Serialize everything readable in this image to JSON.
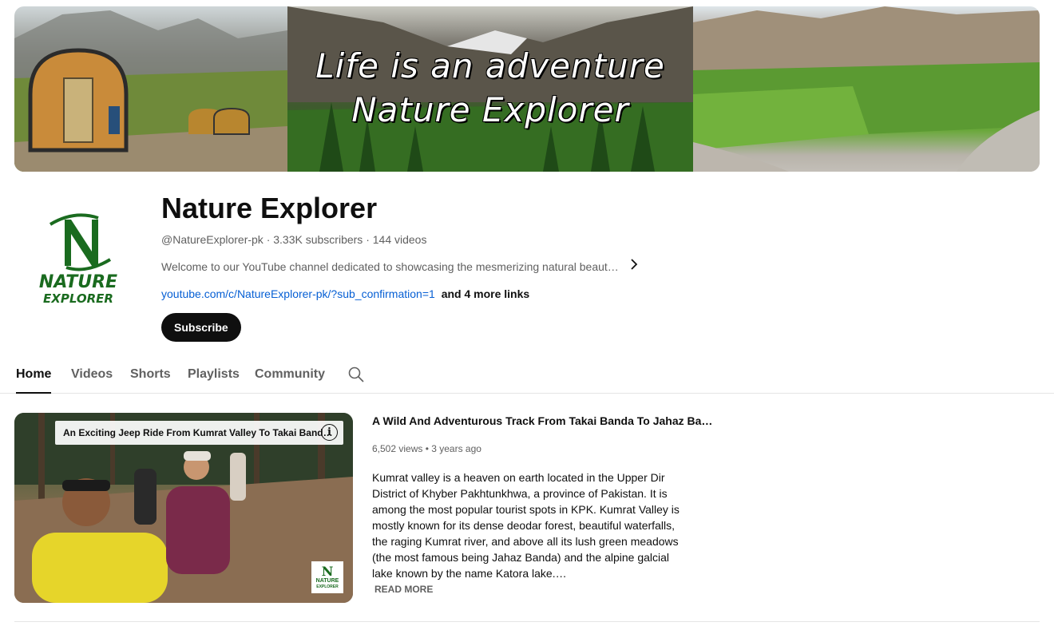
{
  "banner": {
    "line1": "Life is an adventure",
    "line2": "Nature Explorer"
  },
  "avatar": {
    "letter": "N",
    "word1": "NATURE",
    "word2": "EXPLORER",
    "color": "#1a6b1f"
  },
  "channel": {
    "name": "Nature Explorer",
    "meta": "@NatureExplorer-pk · 3.33K subscribers · 144 videos",
    "description": "Welcome to our YouTube channel dedicated to showcasing the mesmerizing natural beaut…",
    "link": "youtube.com/c/NatureExplorer-pk/?sub_confirmation=1",
    "more_links": "and 4 more links",
    "subscribe_label": "Subscribe"
  },
  "tabs": [
    {
      "label": "Home",
      "active": true
    },
    {
      "label": "Videos"
    },
    {
      "label": "Shorts"
    },
    {
      "label": "Playlists"
    },
    {
      "label": "Community"
    }
  ],
  "featured": {
    "thumb_title": "An Exciting Jeep Ride From Kumrat Valley To Takai Band…",
    "thumb_logo_word1": "NATURE",
    "thumb_logo_word2": "EXPLORER",
    "title": "A Wild And Adventurous Track From Takai Banda To Jahaz Ba…",
    "meta": "6,502 views • 3 years ago",
    "description": "Kumrat valley is a heaven on earth located in the Upper Dir District of Khyber Pakhtunkhwa, a province of Pakistan. It is among the most popular tourist spots in KPK. Kumrat Valley is mostly known for its dense deodar forest, beautiful waterfalls, the raging Kumrat river, and above all its lush green meadows (the most famous being Jahaz Banda) and the alpine galcial lake known by the name Katora lake.…",
    "read_more": "READ MORE"
  },
  "icons": {
    "chevron": "chevron-right-icon",
    "search": "search-icon",
    "info": "info-icon"
  }
}
